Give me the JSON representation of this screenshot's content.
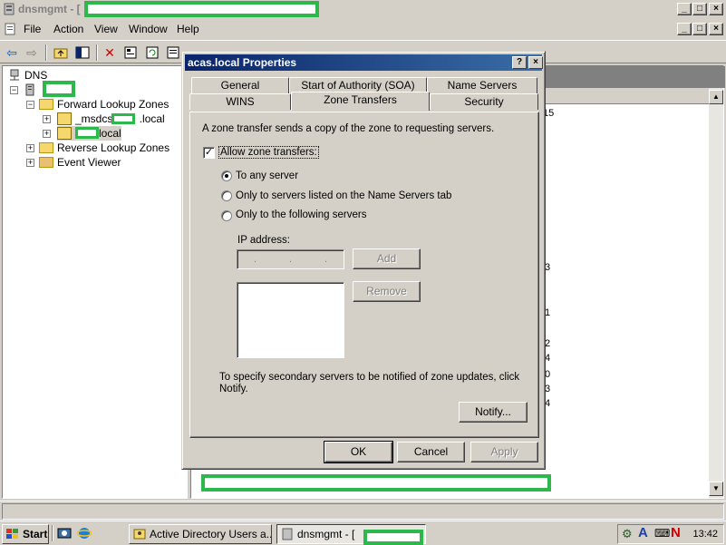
{
  "window": {
    "title": "dnsmgmt - [",
    "controls": [
      "_",
      "□",
      "×"
    ]
  },
  "menubar": {
    "items": [
      {
        "label": "File"
      },
      {
        "label": "Action"
      },
      {
        "label": "View"
      },
      {
        "label": "Window"
      },
      {
        "label": "Help"
      }
    ]
  },
  "tree": {
    "root": "DNS",
    "forward_zones": "Forward Lookup Zones",
    "msdcs_prefix": "_msdcs.",
    "msdcs_suffix": ".local",
    "zone_suffix": "local",
    "reverse_zones": "Reverse Lookup Zones",
    "event_viewer": "Event Viewer"
  },
  "right_pane": {
    "fragments": [
      "15",
      "3",
      "1",
      "2",
      "4",
      "0",
      "3",
      "4"
    ]
  },
  "dialog": {
    "title": "acas.local Properties",
    "title_buttons": [
      "?",
      "×"
    ],
    "tabs_row1": [
      "General",
      "Start of Authority (SOA)",
      "Name Servers"
    ],
    "tabs_row2": [
      "WINS",
      "Zone Transfers",
      "Security"
    ],
    "selected_tab": "Zone Transfers",
    "description": "A zone transfer sends a copy of the zone to requesting servers.",
    "allow_checkbox": {
      "label": "Allow zone transfers:",
      "checked": true
    },
    "radios": [
      {
        "label": "To any server",
        "selected": true
      },
      {
        "label": "Only to servers listed on the Name Servers tab",
        "selected": false
      },
      {
        "label": "Only to the following servers",
        "selected": false
      }
    ],
    "ip_label": "IP address:",
    "ip_placeholder": ". . .",
    "add_button": "Add",
    "remove_button": "Remove",
    "notify_text_1": "To specify secondary servers to be notified of zone updates, click",
    "notify_text_2": "Notify.",
    "notify_button": "Notify...",
    "ok_button": "OK",
    "cancel_button": "Cancel",
    "apply_button": "Apply"
  },
  "taskbar": {
    "start": "Start",
    "tasks": [
      {
        "label": "Active Directory Users a..."
      },
      {
        "label": "dnsmgmt - ["
      }
    ],
    "clock": "13:42"
  },
  "colors": {
    "redaction": "#2db84b",
    "dialog_title": "#0a246a",
    "face": "#d4d0c8"
  }
}
